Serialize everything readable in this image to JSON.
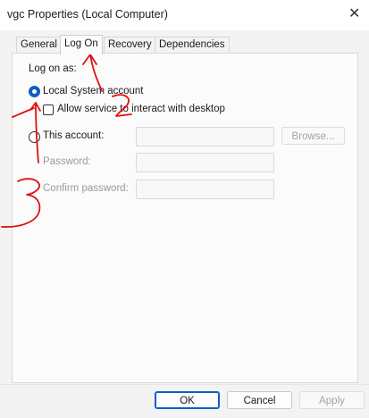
{
  "window": {
    "title": "vgc Properties (Local Computer)",
    "close_glyph": "✕"
  },
  "tabs": [
    {
      "label": "General"
    },
    {
      "label": "Log On"
    },
    {
      "label": "Recovery"
    },
    {
      "label": "Dependencies"
    }
  ],
  "logon": {
    "group_label": "Log on as:",
    "local_system_label": "Local System account",
    "local_system_selected": true,
    "interact_label": "Allow service to interact with desktop",
    "interact_checked": false,
    "this_account_label": "This account:",
    "this_account_selected": false,
    "browse_label": "Browse...",
    "password_label": "Password:",
    "confirm_label": "Confirm password:",
    "account_value": "",
    "password_value": "",
    "confirm_value": ""
  },
  "buttons": {
    "ok": "OK",
    "cancel": "Cancel",
    "apply": "Apply"
  },
  "annotations": {
    "marks": [
      "1",
      "2",
      "3"
    ],
    "color": "#e01010"
  },
  "colors": {
    "accent": "#0f5ec8",
    "annotation": "#e01010"
  }
}
